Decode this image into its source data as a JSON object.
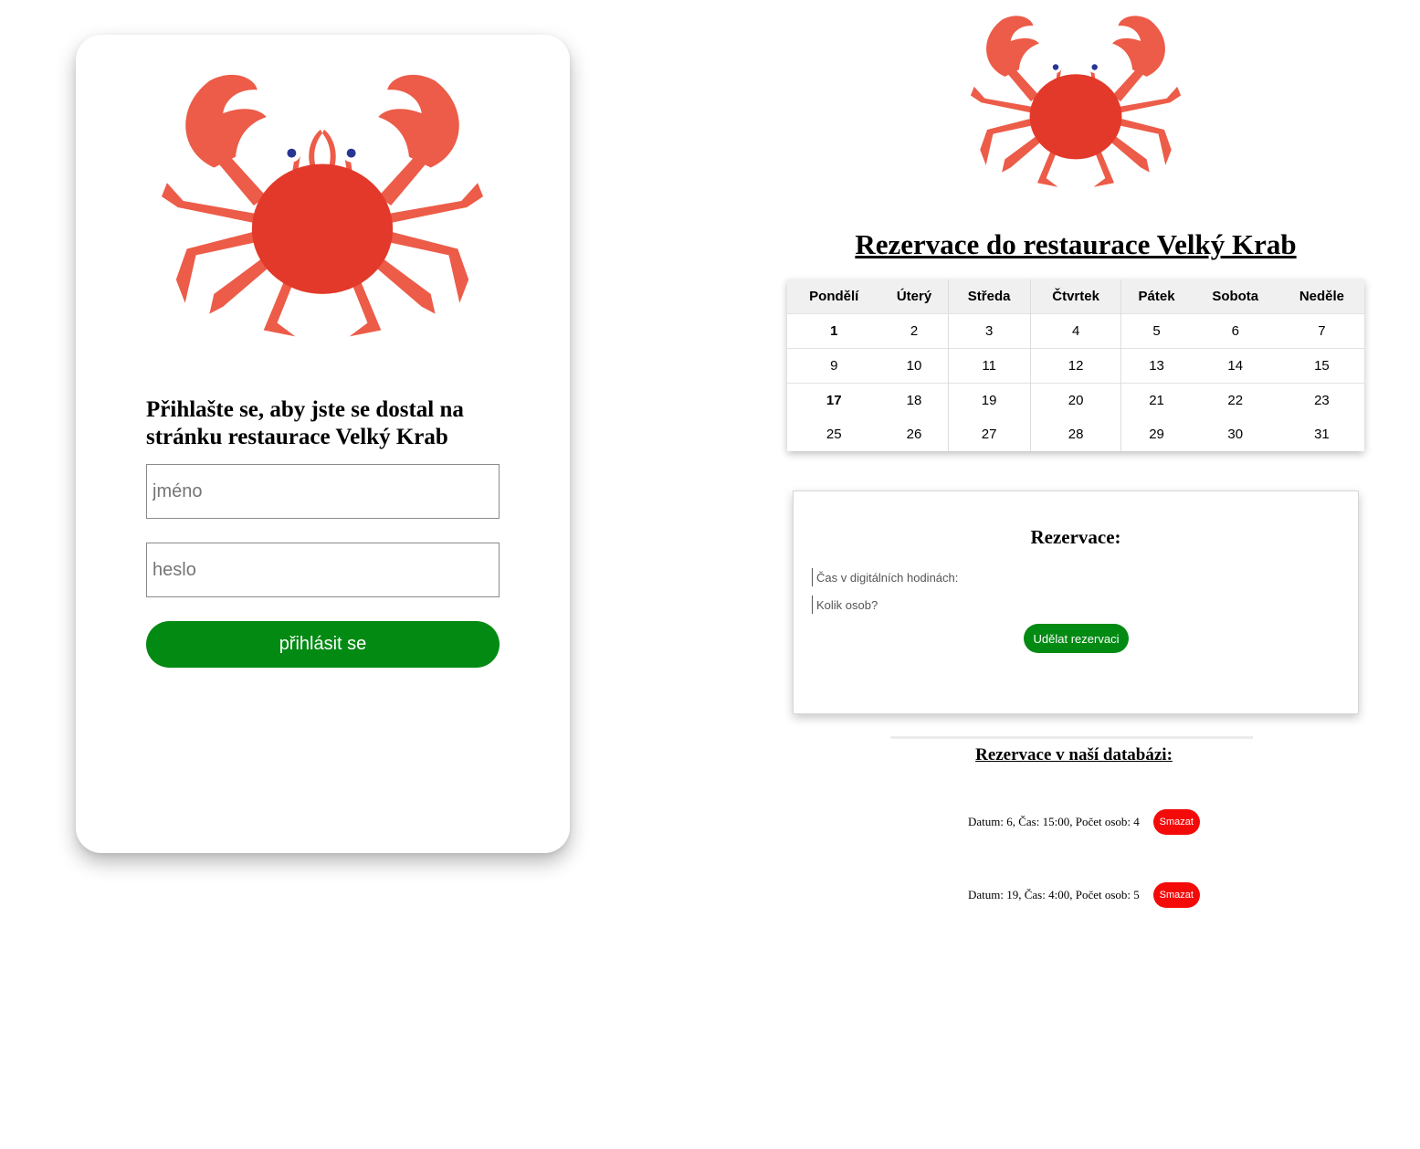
{
  "colors": {
    "crab": "#e2392a",
    "crab_light": "#ec5c48",
    "primary_button": "#038a13",
    "delete_button": "#f50a0a"
  },
  "login": {
    "logo_icon": "crab-icon",
    "heading": "Přihlašte se, aby jste se dostal na stránku restaurace Velký Krab",
    "name_placeholder": "jméno",
    "password_placeholder": "heslo",
    "submit_label": "přihlásit se"
  },
  "main": {
    "logo_icon": "crab-icon",
    "title": "Rezervace do restaurace Velký Krab"
  },
  "calendar": {
    "headers": [
      "Pondělí",
      "Úterý",
      "Středa",
      "Čtvrtek",
      "Pátek",
      "Sobota",
      "Neděle"
    ],
    "rows": [
      [
        "1",
        "2",
        "3",
        "4",
        "5",
        "6",
        "7"
      ],
      [
        "9",
        "10",
        "11",
        "12",
        "13",
        "14",
        "15"
      ],
      [
        "17",
        "18",
        "19",
        "20",
        "21",
        "22",
        "23"
      ],
      [
        "25",
        "26",
        "27",
        "28",
        "29",
        "30",
        "31"
      ]
    ]
  },
  "reservation": {
    "heading": "Rezervace:",
    "time_placeholder": "Čas v digitálních hodinách:",
    "count_placeholder": "Kolik osob?",
    "submit_label": "Udělat rezervaci"
  },
  "database": {
    "heading": "Rezervace v naší databázi:",
    "delete_label": "Smazat",
    "entries": [
      "Datum: 6, Čas: 15:00, Počet osob: 4",
      "Datum: 19, Čas: 4:00, Počet osob: 5"
    ]
  }
}
